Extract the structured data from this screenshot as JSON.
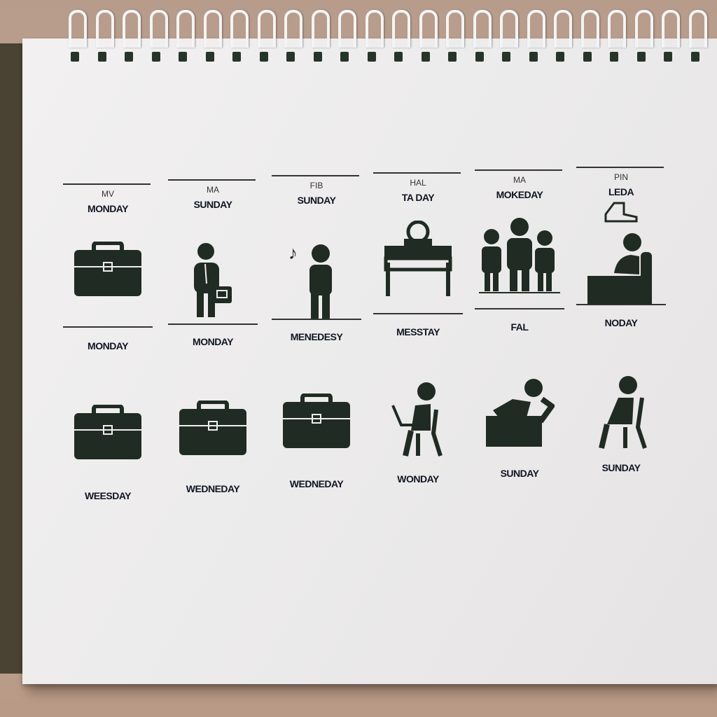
{
  "colors": {
    "icon": "#1f2b23",
    "paper": "#efeded",
    "background": "#bca191"
  },
  "header_row": [
    {
      "small": "MV",
      "big": "MONDAY"
    },
    {
      "small": "MA",
      "big": "SUNDAY"
    },
    {
      "small": "FIB",
      "big": "SUNDAY"
    },
    {
      "small": "HAL",
      "big": "TA DAY"
    },
    {
      "small": "MA",
      "big": "MOKEDAY"
    },
    {
      "small": "PIN",
      "big": "LEDA",
      "icon": "shoe-icon"
    }
  ],
  "row1": [
    {
      "icon": "briefcase-icon",
      "label": "MONDAY"
    },
    {
      "icon": "person-with-briefcase-icon",
      "label": "MONDAY"
    },
    {
      "icon": "person-with-music-note-icon",
      "label": "MENEDESY"
    },
    {
      "icon": "person-at-desk-icon",
      "label": "MESSTAY"
    },
    {
      "icon": "group-of-people-icon",
      "label": "FAL"
    },
    {
      "icon": "person-on-sofa-icon",
      "label": "NODAY"
    }
  ],
  "row2": [
    {
      "icon": "briefcase-icon",
      "label": "WEESDAY"
    },
    {
      "icon": "briefcase-icon",
      "label": "WEDNEDAY"
    },
    {
      "icon": "briefcase-icon",
      "label": "WEDNEDAY"
    },
    {
      "icon": "person-with-laptop-icon",
      "label": "WONDAY"
    },
    {
      "icon": "person-reclining-icon",
      "label": "SUNDAY"
    },
    {
      "icon": "person-sitting-on-chair-icon",
      "label": "SUNDAY"
    }
  ]
}
